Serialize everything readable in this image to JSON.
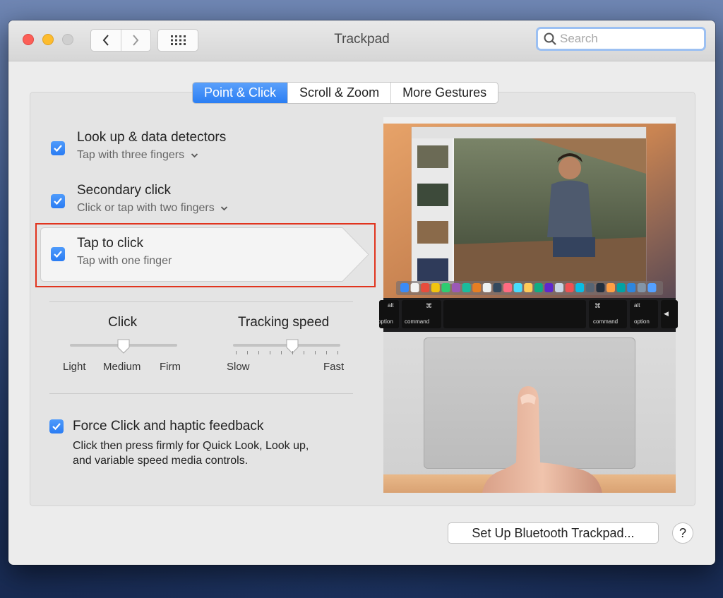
{
  "window": {
    "title": "Trackpad"
  },
  "search": {
    "placeholder": "Search"
  },
  "tabs": [
    {
      "label": "Point & Click",
      "active": true
    },
    {
      "label": "Scroll & Zoom",
      "active": false
    },
    {
      "label": "More Gestures",
      "active": false
    }
  ],
  "options": {
    "lookup": {
      "title": "Look up & data detectors",
      "subtitle": "Tap with three fingers",
      "checked": true
    },
    "secondary": {
      "title": "Secondary click",
      "subtitle": "Click or tap with two fingers",
      "checked": true
    },
    "tap": {
      "title": "Tap to click",
      "subtitle": "Tap with one finger",
      "checked": true
    }
  },
  "sliders": {
    "click": {
      "title": "Click",
      "labels": [
        "Light",
        "Medium",
        "Firm"
      ],
      "value": "Medium"
    },
    "tracking": {
      "title": "Tracking speed",
      "min_label": "Slow",
      "max_label": "Fast",
      "level": 0.55
    }
  },
  "force_click": {
    "title": "Force Click and haptic feedback",
    "line1": "Click then press firmly for Quick Look, Look up,",
    "line2": "and variable speed media controls.",
    "checked": true
  },
  "illustration": {
    "keys": {
      "alt_left": "alt",
      "option_left": "option",
      "cmd_left": "command",
      "cmd_right": "command",
      "alt_right": "alt",
      "option_right": "option"
    }
  },
  "footer": {
    "bluetooth_label": "Set Up Bluetooth Trackpad...",
    "help_label": "?"
  },
  "colors": {
    "accent": "#2b7ef3",
    "highlight_frame": "#e1341e",
    "close": "#fc5f57",
    "minimize": "#fdbc2e"
  }
}
